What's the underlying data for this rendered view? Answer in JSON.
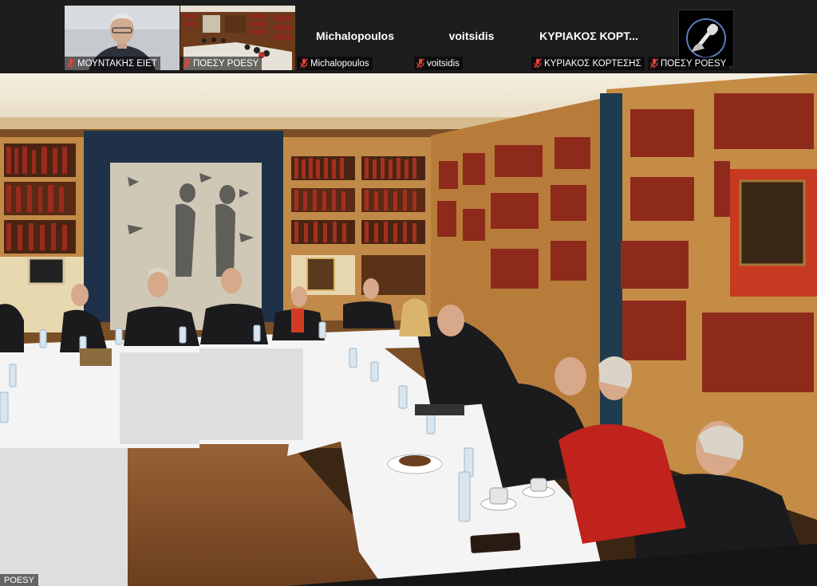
{
  "participants": [
    {
      "name_label": "ΜΟΥΝΤΑΚΗΣ ΕΙΕΤ",
      "display": "video",
      "muted": true
    },
    {
      "name_label": "ΠΟΕΣΥ POESY",
      "display": "video",
      "muted": true,
      "selected": true
    },
    {
      "name_label": "Michalopoulos",
      "display_name": "Michalopoulos",
      "display": "name",
      "muted": true
    },
    {
      "name_label": "voitsidis",
      "display_name": "voitsidis",
      "display": "name",
      "muted": true
    },
    {
      "name_label": "ΚΥΡΙΑΚΟΣ ΚΟΡΤΕΣΗΣ",
      "display_name": "ΚΥΡΙΑΚΟΣ ΚΟΡΤ...",
      "display": "name",
      "muted": true
    },
    {
      "name_label": "ΠΟΕΣΥ POESY",
      "display": "avatar",
      "muted": true
    }
  ],
  "main_video": {
    "speaker_label": "POESY"
  },
  "colors": {
    "strip_bg": "#1d1d1d",
    "selected_outline": "#c7c34a",
    "mic_muted": "#e0443c"
  },
  "icons": {
    "mic": "mic-muted-icon",
    "avatar": "microphone-hand-icon"
  }
}
